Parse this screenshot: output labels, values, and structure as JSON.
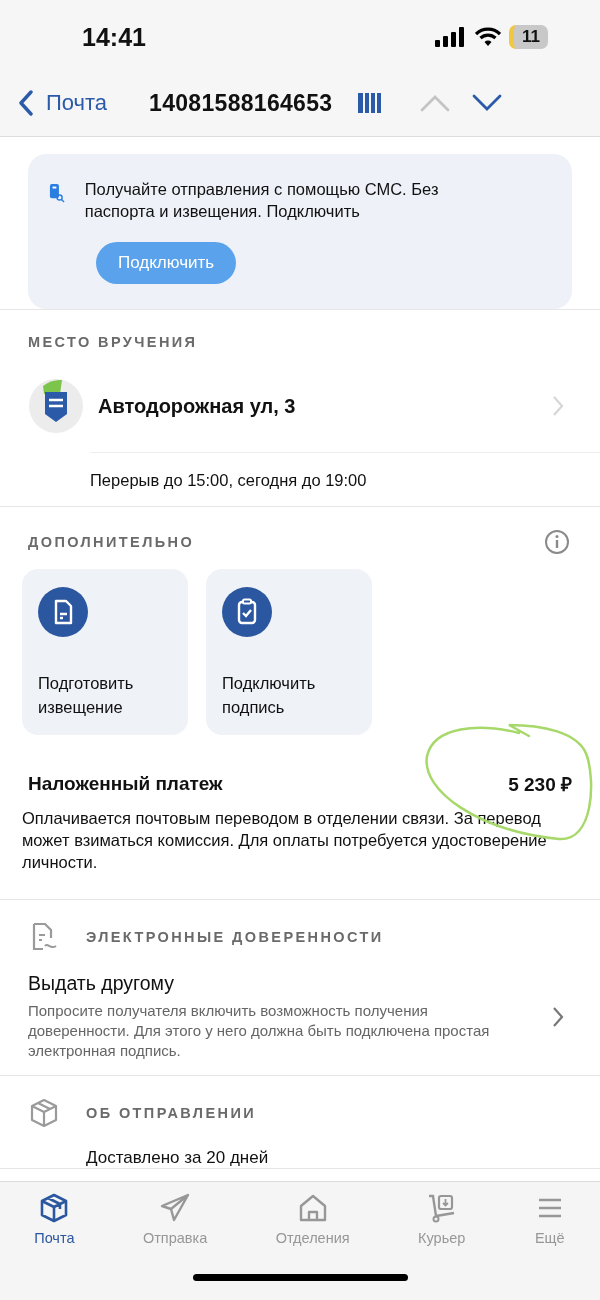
{
  "status_bar": {
    "time": "14:41",
    "battery": "11"
  },
  "nav": {
    "back": "Почта",
    "title": "14081588164653"
  },
  "sms_banner": {
    "text": "Получайте отправления с помощью СМС. Без паспорта и извещения. Подключить",
    "button": "Подключить"
  },
  "delivery_place": {
    "heading": "МЕСТО ВРУЧЕНИЯ",
    "address": "Автодорожная ул, 3",
    "hours": "Перерыв до 15:00, сегодня до 19:00"
  },
  "additional": {
    "heading": "ДОПОЛНИТЕЛЬНО",
    "actions": [
      {
        "kind": "document",
        "label": "Подготовить извещение"
      },
      {
        "kind": "clipboard",
        "label": "Подключить подпись"
      }
    ],
    "cod_title": "Наложенный платеж",
    "cod_amount": "5 230 ₽",
    "cod_text": "Оплачивается почтовым переводом в отделении связи. За перевод может взиматься комиссия. Для оплаты потребуется удостоверение личности."
  },
  "e_powers": {
    "heading": "ЭЛЕКТРОННЫЕ ДОВЕРЕННОСТИ",
    "title": "Выдать другому",
    "text": "Попросите получателя включить возможность получения доверенности. Для этого у него должна быть подключена простая электронная подпись."
  },
  "about": {
    "heading": "ОБ ОТПРАВЛЕНИИ",
    "text": "Доставлено за 20 дней"
  },
  "tabs": [
    {
      "kind": "box",
      "label": "Почта",
      "selected": true
    },
    {
      "kind": "plane",
      "label": "Отправка",
      "selected": false
    },
    {
      "kind": "house",
      "label": "Отделения",
      "selected": false
    },
    {
      "kind": "cart",
      "label": "Курьер",
      "selected": false
    },
    {
      "kind": "menu",
      "label": "Ещё",
      "selected": false
    }
  ]
}
